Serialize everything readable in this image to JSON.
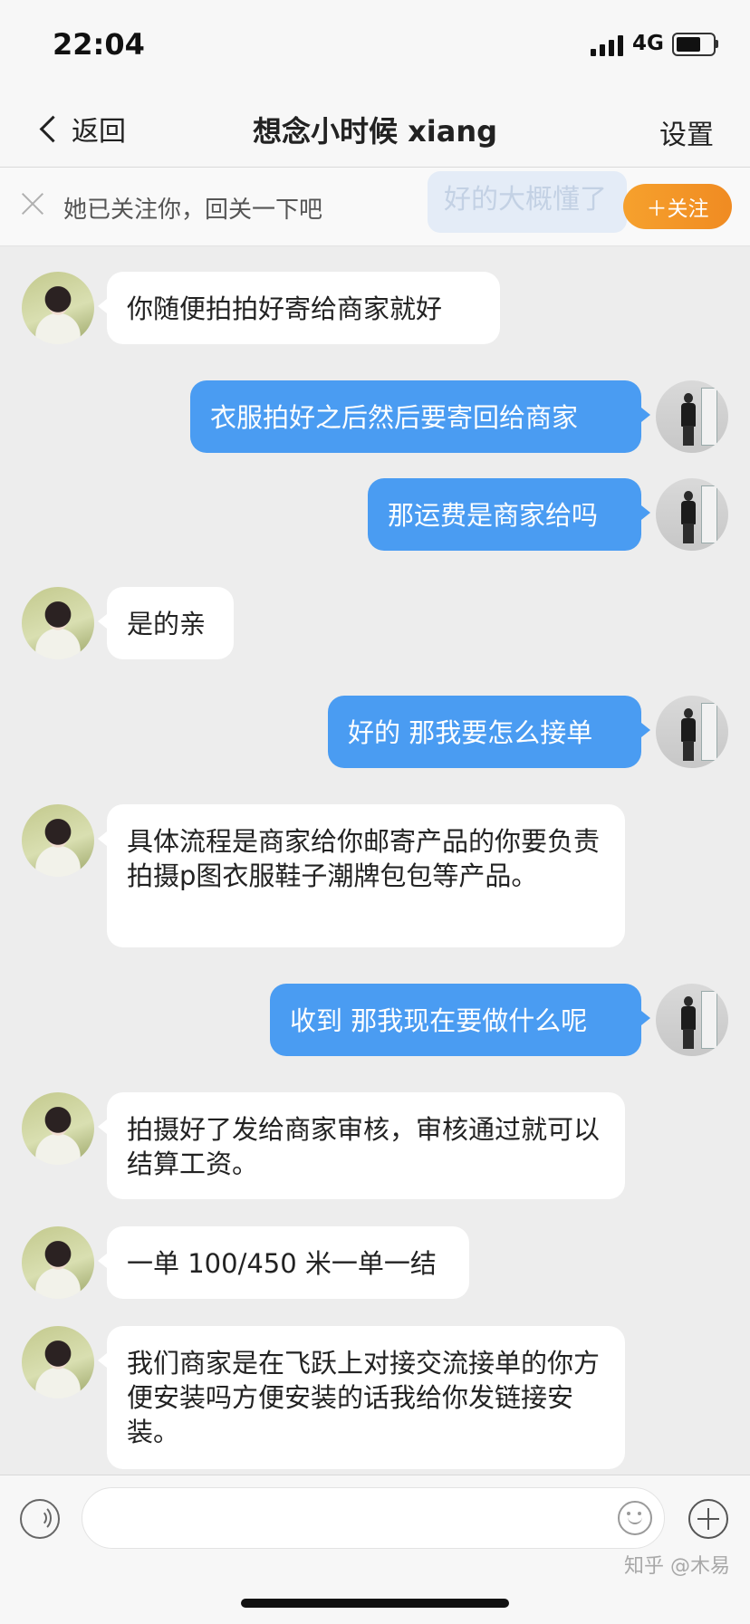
{
  "status": {
    "time": "22:04",
    "network": "4G"
  },
  "nav": {
    "back_label": "返回",
    "title": "想念小时候 xiang",
    "settings_label": "设置"
  },
  "follow_bar": {
    "text": "她已关注你，回关一下吧",
    "ghost_text": "好的大概懂了",
    "follow_button": "＋关注"
  },
  "messages": [
    {
      "side": "left",
      "text": "你随便拍拍好寄给商家就好"
    },
    {
      "side": "right",
      "text": "衣服拍好之后然后要寄回给商家"
    },
    {
      "side": "right",
      "text": "那运费是商家给吗"
    },
    {
      "side": "left",
      "text": "是的亲"
    },
    {
      "side": "right",
      "text": "好的 那我要怎么接单"
    },
    {
      "side": "left",
      "text": "具体流程是商家给你邮寄产品的你要负责拍摄p图衣服鞋子潮牌包包等产品。"
    },
    {
      "side": "right",
      "text": "收到 那我现在要做什么呢"
    },
    {
      "side": "left",
      "text": "拍摄好了发给商家审核，审核通过就可以结算工资。"
    },
    {
      "side": "left",
      "text": "一单 100/450 米一单一结"
    },
    {
      "side": "left",
      "text": "我们商家是在飞跃上对接交流接单的你方便安装吗方便安装的话我给你发链接安装。"
    }
  ],
  "input": {
    "value": ""
  },
  "watermark": "知乎 @木易",
  "colors": {
    "bubble_self": "#4a9cf2",
    "bubble_other": "#ffffff",
    "follow_button": "#f08b22",
    "background": "#ededed"
  },
  "icons": [
    "back-chevron-icon",
    "close-icon",
    "voice-icon",
    "emoji-icon",
    "plus-icon",
    "signal-icon",
    "battery-icon"
  ]
}
